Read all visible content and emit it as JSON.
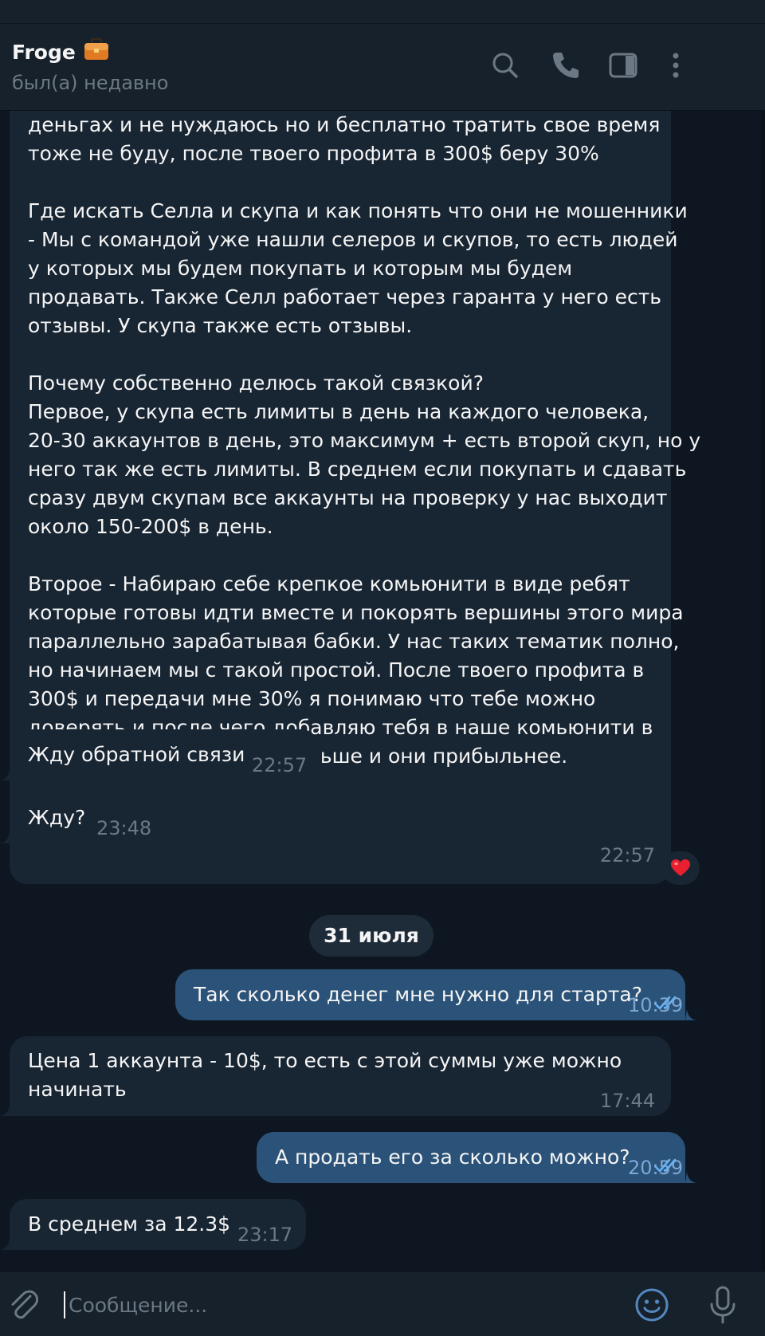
{
  "header": {
    "title": "Froge",
    "status": "был(а) недавно",
    "icons": [
      "search-icon",
      "phone-icon",
      "sidebar-toggle-icon",
      "more-vertical-icon",
      "briefcase-icon"
    ]
  },
  "messages": [
    {
      "direction": "in",
      "text": "деньгах и не нуждаюсь но и бесплатно тратить свое время\nтоже не буду, после твоего профита в 300$ беру 30%\n\nГде искать Селла и скупа и как понять что они не мошенники\n- Мы с командой уже нашли селеров и скупов, то есть людей\nу которых мы будем покупать и которым мы будем\nпродавать. Также Селл работает через гаранта у него есть\nотзывы. У скупа также есть отзывы.\n\nПочему собственно делюсь такой связкой?\nПервое, у скупа есть лимиты в день на каждого человека,\n20-30 аккаунтов в день, это максимум + есть второй скуп, но у\nнего так же есть лимиты. В среднем если покупать и сдавать\nсразу двум скупам все аккаунты на проверку у нас выходит\nоколо 150-200$ в день.\n\nВторое - Набираю себе крепкое комьюнити в виде ребят\nкоторые готовы идти вместе и покорять вершины этого мира\nпараллельно зарабатывая бабки. У нас таких тематик полно,\nно начинаем мы с такой простой. После твоего профита в\n300$ и передачи мне 30% я понимаю что тебе можно\nдоверять и после чего добавляю тебя в наше комьюнити в\nкотором таких тематик больше и они прибыльнее.",
      "time": "22:57",
      "reaction": "❤️"
    },
    {
      "direction": "in",
      "text": "Жду обратной связи",
      "time": "22:57"
    },
    {
      "direction": "in",
      "text": "Жду?",
      "time": "23:48"
    },
    {
      "direction": "out",
      "text": "Так сколько денег мне нужно для старта?",
      "time": "10:39"
    },
    {
      "direction": "in",
      "text": "Цена 1 аккаунта - 10$, то есть с этой суммы уже можно\nначинать",
      "time": "17:44"
    },
    {
      "direction": "out",
      "text": "А продать его за сколько можно?",
      "time": "20:59"
    },
    {
      "direction": "in",
      "text": "В среднем за 12.3$",
      "time": "23:17"
    }
  ],
  "date_separator": "31 июля",
  "composer": {
    "placeholder": "Сообщение...",
    "value": "",
    "icons": [
      "attach-icon",
      "emoji-icon",
      "microphone-icon"
    ]
  },
  "colors": {
    "background": "#0e1621",
    "header": "#17212b",
    "incoming_bubble": "#182533",
    "outgoing_bubble": "#2b5278",
    "read_check": "#6ab3f3",
    "accent": "#5288c1",
    "reaction": "#e8202f"
  }
}
